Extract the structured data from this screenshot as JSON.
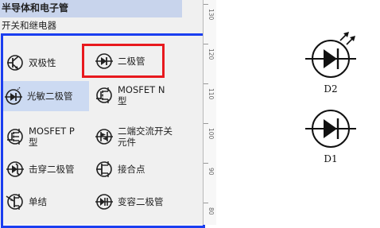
{
  "category_header": "半导体和电子管",
  "subcategory": "开关和继电器",
  "ruler": {
    "marks": [
      "130",
      "120",
      "110",
      "100",
      "90",
      "80"
    ]
  },
  "palette": {
    "items": [
      {
        "label": "双极性",
        "icon": "bipolar-transistor-icon"
      },
      {
        "label": "二极管",
        "icon": "diode-icon",
        "highlighted": true
      },
      {
        "label": "光敏二极管",
        "icon": "photodiode-icon",
        "selected": true
      },
      {
        "label_line1": "MOSFET N",
        "label_line2": "型",
        "icon": "mosfet-n-icon"
      },
      {
        "label_line1": "MOSFET P",
        "label_line2": "型",
        "icon": "mosfet-p-icon"
      },
      {
        "label_line1": "二端交流开关",
        "label_line2": "元件",
        "icon": "diac-icon"
      },
      {
        "label": "击穿二极管",
        "icon": "zener-diode-icon"
      },
      {
        "label": "接合点",
        "icon": "junction-icon"
      },
      {
        "label": "单结",
        "icon": "unijunction-transistor-icon"
      },
      {
        "label": "变容二极管",
        "icon": "varactor-diode-icon"
      }
    ]
  },
  "canvas": {
    "components": [
      {
        "label": "D2",
        "icon": "led-diode-icon"
      },
      {
        "label": "D1",
        "icon": "diode-icon"
      }
    ]
  },
  "colors": {
    "selection_frame": "#1a3ef0",
    "highlight_frame": "#e8191e",
    "selected_item_bg": "#ccdaf2",
    "header_bg": "#c8d4ec"
  }
}
